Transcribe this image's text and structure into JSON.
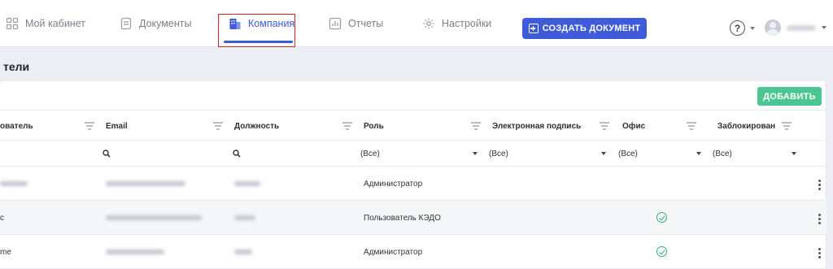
{
  "nav": {
    "items": [
      {
        "label": "Мой кабинет",
        "icon": "grid-icon"
      },
      {
        "label": "Документы",
        "icon": "document-icon"
      },
      {
        "label": "Компания",
        "icon": "building-icon",
        "active": true
      },
      {
        "label": "Отчеты",
        "icon": "chart-icon"
      },
      {
        "label": "Настройки",
        "icon": "gear-icon"
      }
    ],
    "create_button": "СОЗДАТЬ ДОКУМЕНТ",
    "help_icon": "help-icon"
  },
  "page": {
    "section_title": "тели",
    "add_button": "ДОБАВИТЬ"
  },
  "table": {
    "columns": [
      "ователь",
      "Email",
      "Должность",
      "Роль",
      "Электронная подпись",
      "Офис",
      "Заблокирован"
    ],
    "filters": {
      "role": "(Все)",
      "signature": "(Все)",
      "office": "(Все)",
      "blocked": "(Все)"
    },
    "rows": [
      {
        "name_suffix": "",
        "role": "Администратор",
        "office_checked": false
      },
      {
        "name_suffix": "с",
        "role": "Пользователь КЭДО",
        "office_checked": true
      },
      {
        "name_suffix": "me",
        "role": "Администратор",
        "office_checked": true
      }
    ]
  },
  "colors": {
    "accent": "#3f5bd8",
    "add": "#4bc691",
    "check": "#3aa76d"
  }
}
